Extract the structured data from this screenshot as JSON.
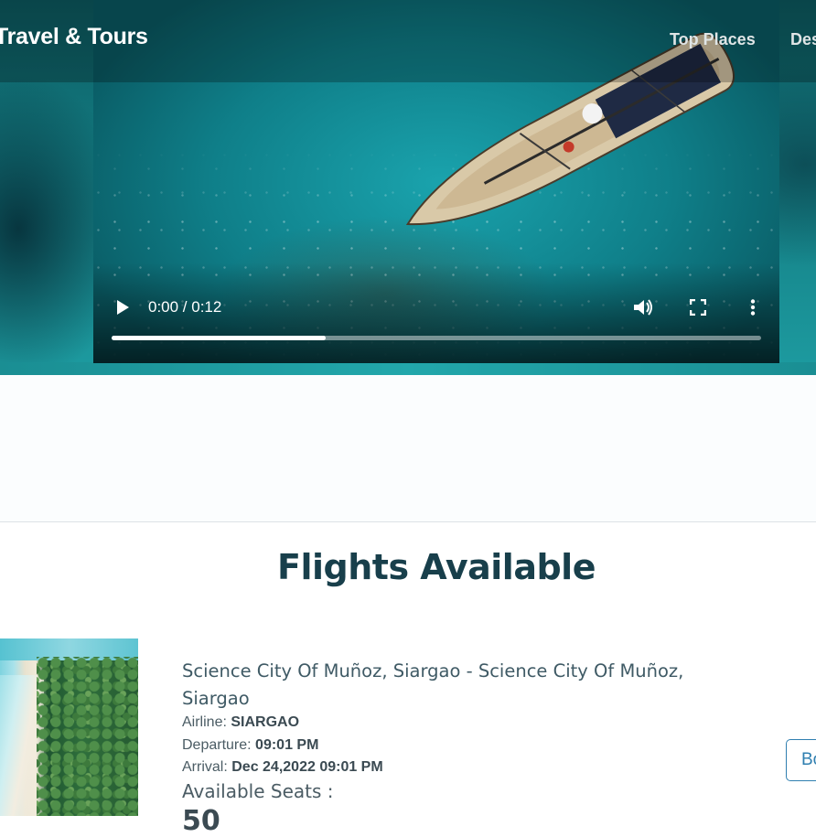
{
  "header": {
    "brand": "Travel & Tours",
    "nav": [
      "Top Places",
      "Destinations"
    ]
  },
  "video": {
    "time": "0:00 / 0:12",
    "progress": 0.33,
    "icons": [
      "play-icon",
      "volume-icon",
      "fullscreen-icon",
      "more-vert-icon"
    ]
  },
  "flights": {
    "title": "Flights Available",
    "items": [
      {
        "route": "Science City Of Muñoz, Siargao - Science City Of Muñoz, Siargao",
        "airline_label": "Airline: ",
        "airline": "SIARGAO",
        "departure_label": "Departure: ",
        "departure": "09:01 PM",
        "arrival_label": "Arrival: ",
        "arrival": "Dec 24,2022 09:01 PM",
        "seats_label": "Available Seats :",
        "seats": "50",
        "book_label": "Book"
      }
    ]
  },
  "colors": {
    "title": "#183f4b",
    "button": "#2f7fb0"
  }
}
